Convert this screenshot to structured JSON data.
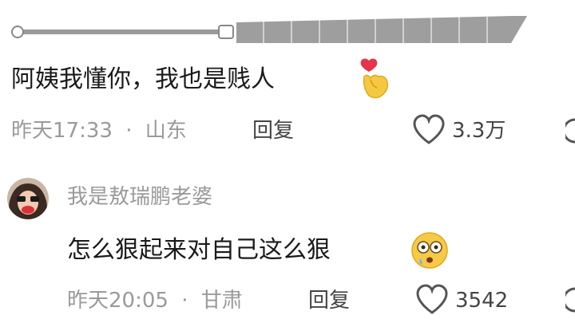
{
  "comments": [
    {
      "text": "阿姨我懂你，我也是贱人",
      "emoji": "finger-heart",
      "time": "昨天17:33",
      "location": "山东",
      "reply_label": "回复",
      "likes": "3.3万"
    },
    {
      "username": "我是敖瑞鹏老婆",
      "text": "怎么狠起来对自己这么狠",
      "emoji": "flushed-face",
      "time": "昨天20:05",
      "location": "甘肃",
      "reply_label": "回复",
      "likes": "3542"
    }
  ],
  "separator": "·"
}
